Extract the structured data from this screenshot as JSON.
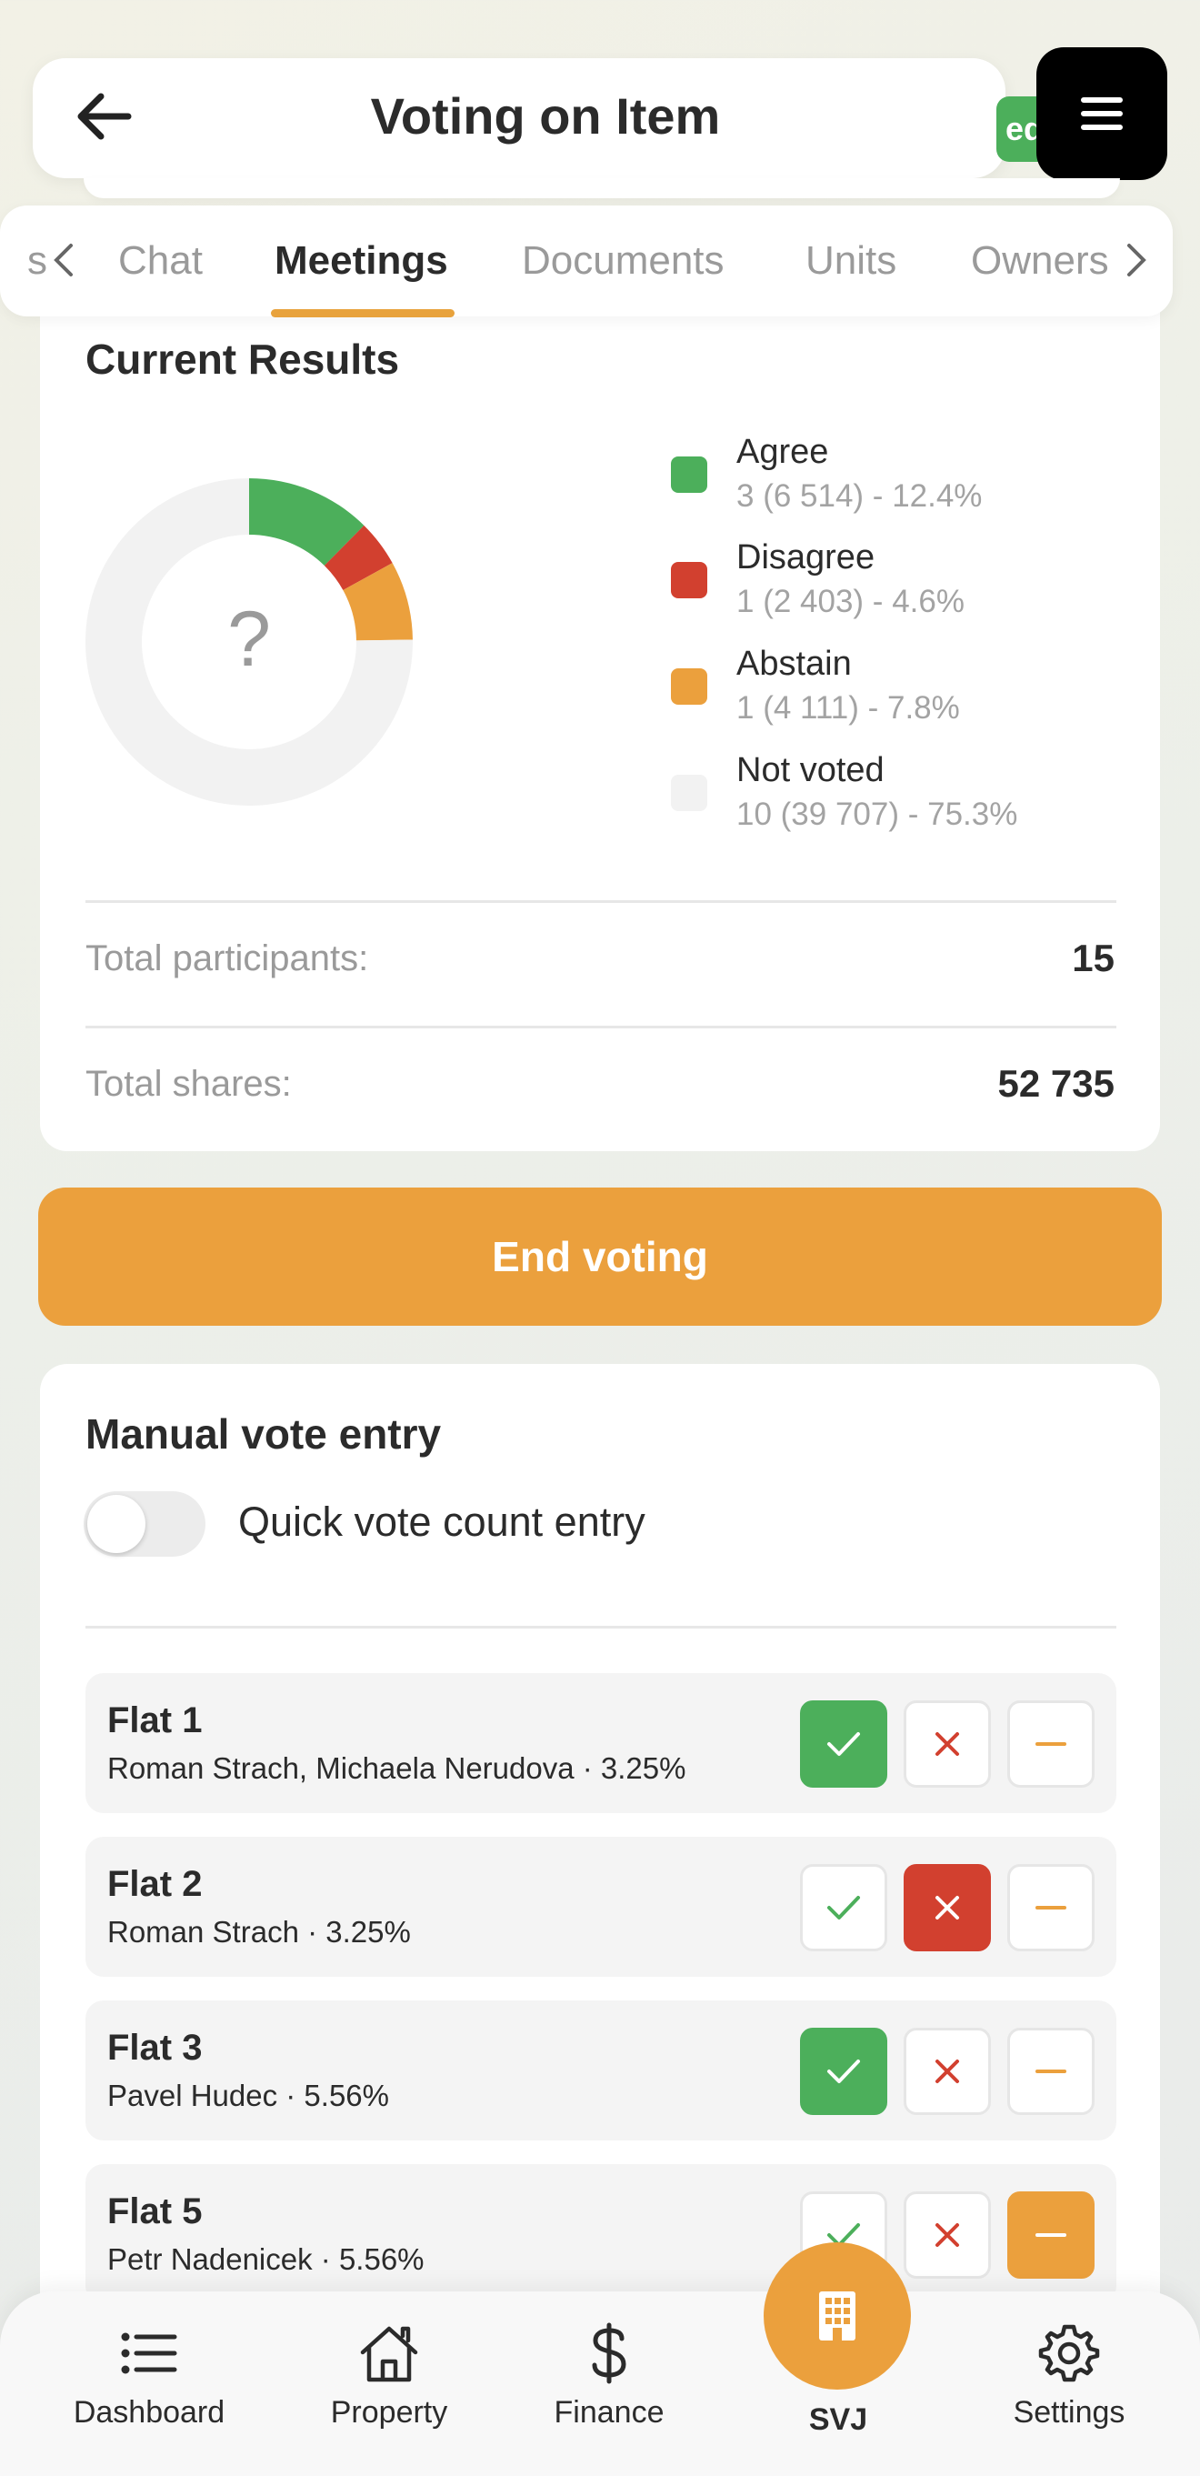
{
  "header": {
    "title": "Voting on Item",
    "status_peek": "ed"
  },
  "tabs": {
    "items": [
      "s",
      "Chat",
      "Meetings",
      "Documents",
      "Units",
      "Owners"
    ],
    "active": "Meetings"
  },
  "results": {
    "title": "Current Results",
    "center_symbol": "?",
    "legend": [
      {
        "label": "Agree",
        "detail": "3 (6 514) - 12.4%",
        "color": "#4caf5b"
      },
      {
        "label": "Disagree",
        "detail": "1 (2 403) - 4.6%",
        "color": "#d2402f"
      },
      {
        "label": "Abstain",
        "detail": "1 (4 111) - 7.8%",
        "color": "#eba03d"
      },
      {
        "label": "Not voted",
        "detail": "10 (39 707) - 75.3%",
        "color": "#f2f2f2"
      }
    ],
    "total_participants_label": "Total participants:",
    "total_participants_value": "15",
    "total_shares_label": "Total shares:",
    "total_shares_value": "52 735"
  },
  "chart_data": {
    "type": "pie",
    "categories": [
      "Agree",
      "Disagree",
      "Abstain",
      "Not voted"
    ],
    "values": [
      12.4,
      4.6,
      7.8,
      75.3
    ],
    "colors": [
      "#4caf5b",
      "#d2402f",
      "#eba03d",
      "#f2f2f2"
    ],
    "donut": true
  },
  "end_voting": {
    "label": "End voting"
  },
  "manual": {
    "title": "Manual vote entry",
    "toggle_label": "Quick vote count entry",
    "toggle_on": false,
    "flats": [
      {
        "name": "Flat 1",
        "owners": "Roman Strach, Michaela Nerudova · 3.25%",
        "vote": "agree"
      },
      {
        "name": "Flat 2",
        "owners": "Roman Strach · 3.25%",
        "vote": "disagree"
      },
      {
        "name": "Flat 3",
        "owners": "Pavel Hudec · 5.56%",
        "vote": "agree"
      },
      {
        "name": "Flat 5",
        "owners": "Petr Nadenicek · 5.56%",
        "vote": "abstain"
      }
    ]
  },
  "nav": {
    "items": [
      {
        "label": "Dashboard",
        "icon": "list-icon"
      },
      {
        "label": "Property",
        "icon": "house-icon"
      },
      {
        "label": "Finance",
        "icon": "dollar-icon"
      },
      {
        "label": "SVJ",
        "icon": "building-icon"
      },
      {
        "label": "Settings",
        "icon": "gear-icon"
      }
    ]
  }
}
